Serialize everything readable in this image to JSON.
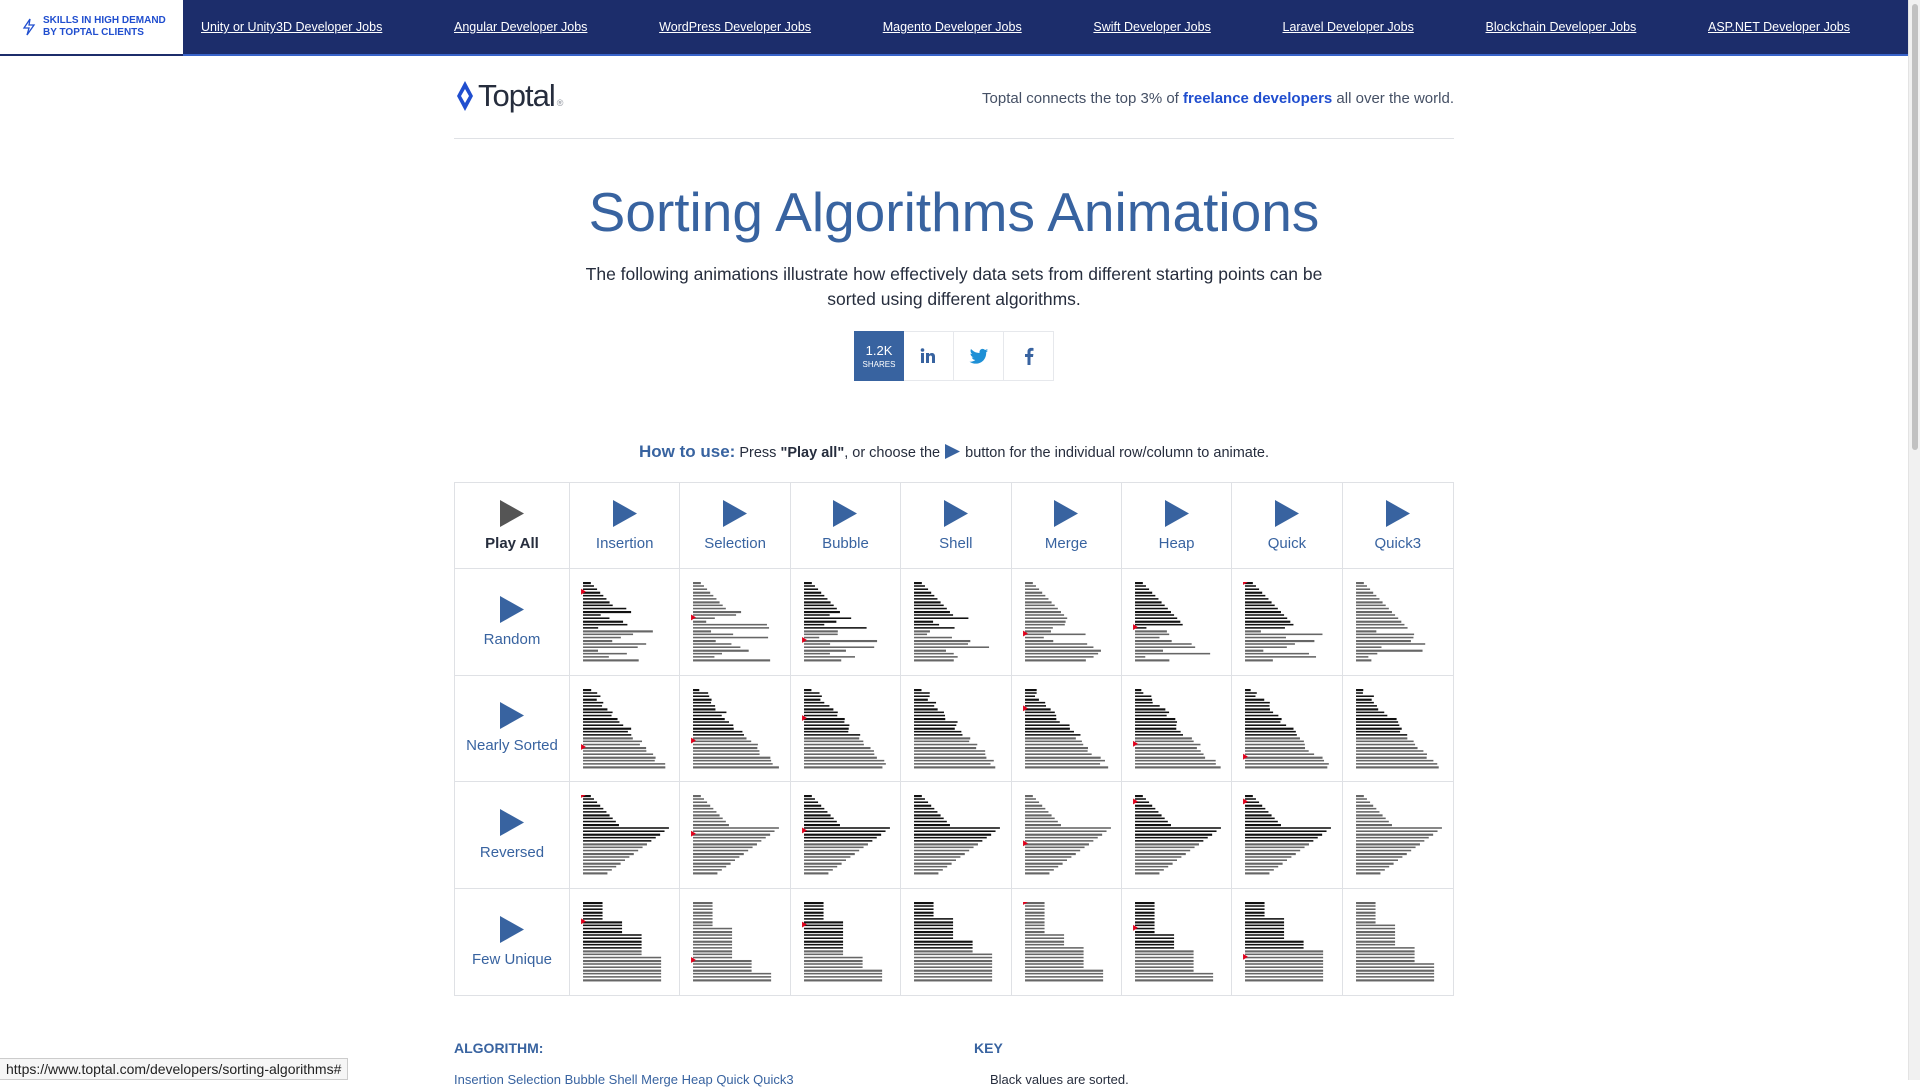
{
  "topbar": {
    "badge": "SKILLS IN HIGH DEMAND\nBY TOPTAL CLIENTS",
    "links": [
      "Unity or Unity3D Developer Jobs",
      "Angular Developer Jobs",
      "WordPress Developer Jobs",
      "Magento Developer Jobs",
      "Swift Developer Jobs",
      "Laravel Developer Jobs",
      "Blockchain Developer Jobs",
      "ASP.NET Developer Jobs"
    ]
  },
  "header": {
    "logo": "Toptal",
    "logo_mark": "®",
    "tagline_before": "Toptal connects the top 3% of ",
    "tagline_link": "freelance developers",
    "tagline_after": " all over the world."
  },
  "hero": {
    "title": "Sorting Algorithms Animations",
    "subtitle": "The following animations illustrate how effectively data sets from different starting points can be sorted using different algorithms."
  },
  "share": {
    "count": "1.2K",
    "label": "SHARES"
  },
  "howto": {
    "heading": "How to use:",
    "text_1": " Press ",
    "play_all": "\"Play all\"",
    "text_2": ", or choose the",
    "text_3": "button for the individual row/column to animate."
  },
  "grid": {
    "play_all_label": "Play All",
    "algorithms": [
      "Insertion",
      "Selection",
      "Bubble",
      "Shell",
      "Merge",
      "Heap",
      "Quick",
      "Quick3"
    ],
    "datasets": [
      "Random",
      "Nearly Sorted",
      "Reversed",
      "Few Unique"
    ]
  },
  "footer": {
    "algorithm_title": "ALGORITHM:",
    "algorithm_links": "Insertion  Selection  Bubble  Shell  Merge  Heap  Quick  Quick3",
    "key_title": "KEY",
    "key_text": "Black values are sorted."
  },
  "status_url": "https://www.toptal.com/developers/sorting-algorithms#",
  "colors": {
    "brand": "#204ecf",
    "accent": "#3863a0",
    "topbar": "#1c2d6b",
    "marker": "#e0001b"
  }
}
